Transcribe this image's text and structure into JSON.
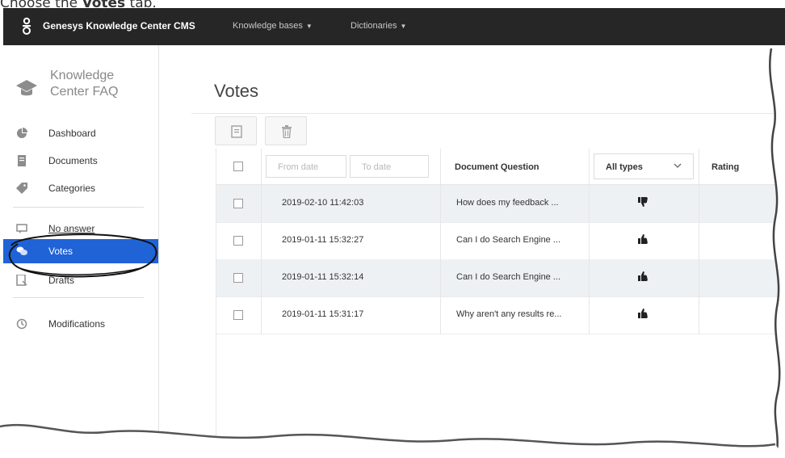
{
  "caption": {
    "prefix": "Choose the ",
    "bold": "Votes",
    "suffix": " tab."
  },
  "topbar": {
    "brand": "Genesys Knowledge Center CMS",
    "nav": [
      {
        "label": "Knowledge bases"
      },
      {
        "label": "Dictionaries"
      }
    ]
  },
  "sidebar": {
    "kb_title_line1": "Knowledge",
    "kb_title_line2": "Center FAQ",
    "items": [
      {
        "label": "Dashboard",
        "icon": "pie-chart-icon"
      },
      {
        "label": "Documents",
        "icon": "document-icon"
      },
      {
        "label": "Categories",
        "icon": "tag-icon"
      },
      {
        "label": "No answer",
        "icon": "message-icon"
      },
      {
        "label": "Votes",
        "icon": "chat-bubbles-icon",
        "active": true
      },
      {
        "label": "Drafts",
        "icon": "draft-icon"
      },
      {
        "label": "Modifications",
        "icon": "history-icon"
      }
    ]
  },
  "main": {
    "title": "Votes",
    "toolbar": {
      "export_icon": "export-icon",
      "delete_icon": "trash-icon"
    },
    "filters": {
      "from_placeholder": "From date",
      "to_placeholder": "To date",
      "type_selected": "All types"
    },
    "columns": {
      "question": "Document Question",
      "rating": "Rating"
    },
    "rows": [
      {
        "date": "2019-02-10 11:42:03",
        "question": "How does my feedback ...",
        "vote": "thumbs-down"
      },
      {
        "date": "2019-01-11 15:32:27",
        "question": "Can I do Search Engine ...",
        "vote": "thumbs-up"
      },
      {
        "date": "2019-01-11 15:32:14",
        "question": "Can I do Search Engine ...",
        "vote": "thumbs-up"
      },
      {
        "date": "2019-01-11 15:31:17",
        "question": "Why aren't any results re...",
        "vote": "thumbs-up"
      }
    ]
  },
  "colors": {
    "topbar": "#262626",
    "active": "#1f63d6",
    "row_alt": "#eef1f4"
  }
}
